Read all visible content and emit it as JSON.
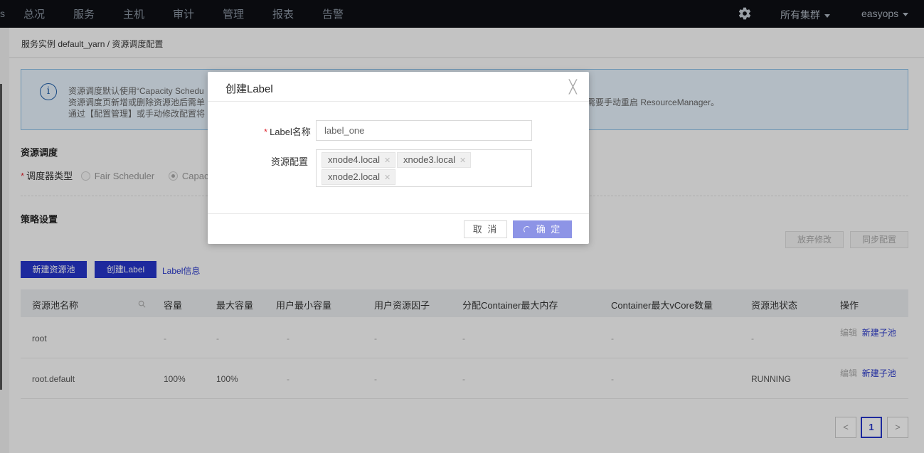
{
  "topnav": {
    "stub": "s",
    "items": [
      "总况",
      "服务",
      "主机",
      "审计",
      "管理",
      "报表",
      "告警"
    ],
    "cluster_select": "所有集群",
    "user_menu": "easyops",
    "settings_icon": "gear-icon"
  },
  "breadcrumb": "服务实例 default_yarn / 资源调度配置",
  "info": {
    "icon": "info-icon",
    "line1": "资源调度默认使用“Capacity Schedu",
    "line2": "资源调度页新增或删除资源池后需单",
    "line3": "通过【配置管理】或手动修改配置将",
    "line2_tail": "需要手动重启 ResourceManager。"
  },
  "scheduling": {
    "title": "资源调度",
    "type_label": "调度器类型",
    "option_fair": "Fair Scheduler",
    "option_capacity": "Capac"
  },
  "policy": {
    "title": "策略设置",
    "discard_button": "放弃修改",
    "sync_button": "同步配置",
    "new_pool_button": "新建资源池",
    "create_label_button": "创建Label",
    "label_info_link": "Label信息"
  },
  "table": {
    "columns": [
      "资源池名称",
      "容量",
      "最大容量",
      "用户最小容量",
      "用户资源因子",
      "分配Container最大内存",
      "Container最大vCore数量",
      "资源池状态",
      "操作"
    ],
    "rows": [
      {
        "name": "root",
        "capacity": "-",
        "max_capacity": "-",
        "user_min": "-",
        "user_factor": "-",
        "max_mem": "-",
        "max_vcore": "-",
        "status": "-",
        "edit": "编辑",
        "new_child": "新建子池"
      },
      {
        "name": "root.default",
        "capacity": "100%",
        "max_capacity": "100%",
        "user_min": "-",
        "user_factor": "-",
        "max_mem": "-",
        "max_vcore": "-",
        "status": "RUNNING",
        "edit": "编辑",
        "new_child": "新建子池"
      }
    ]
  },
  "pagination": {
    "prev": "<",
    "current": "1",
    "next": ">"
  },
  "modal": {
    "title": "创建Label",
    "close": "╳",
    "label_name_label": "Label名称",
    "label_name_value": "label_one",
    "resource_label": "资源配置",
    "tags": [
      "xnode4.local",
      "xnode3.local",
      "xnode2.local"
    ],
    "cancel": "取 消",
    "ok": "确 定"
  }
}
